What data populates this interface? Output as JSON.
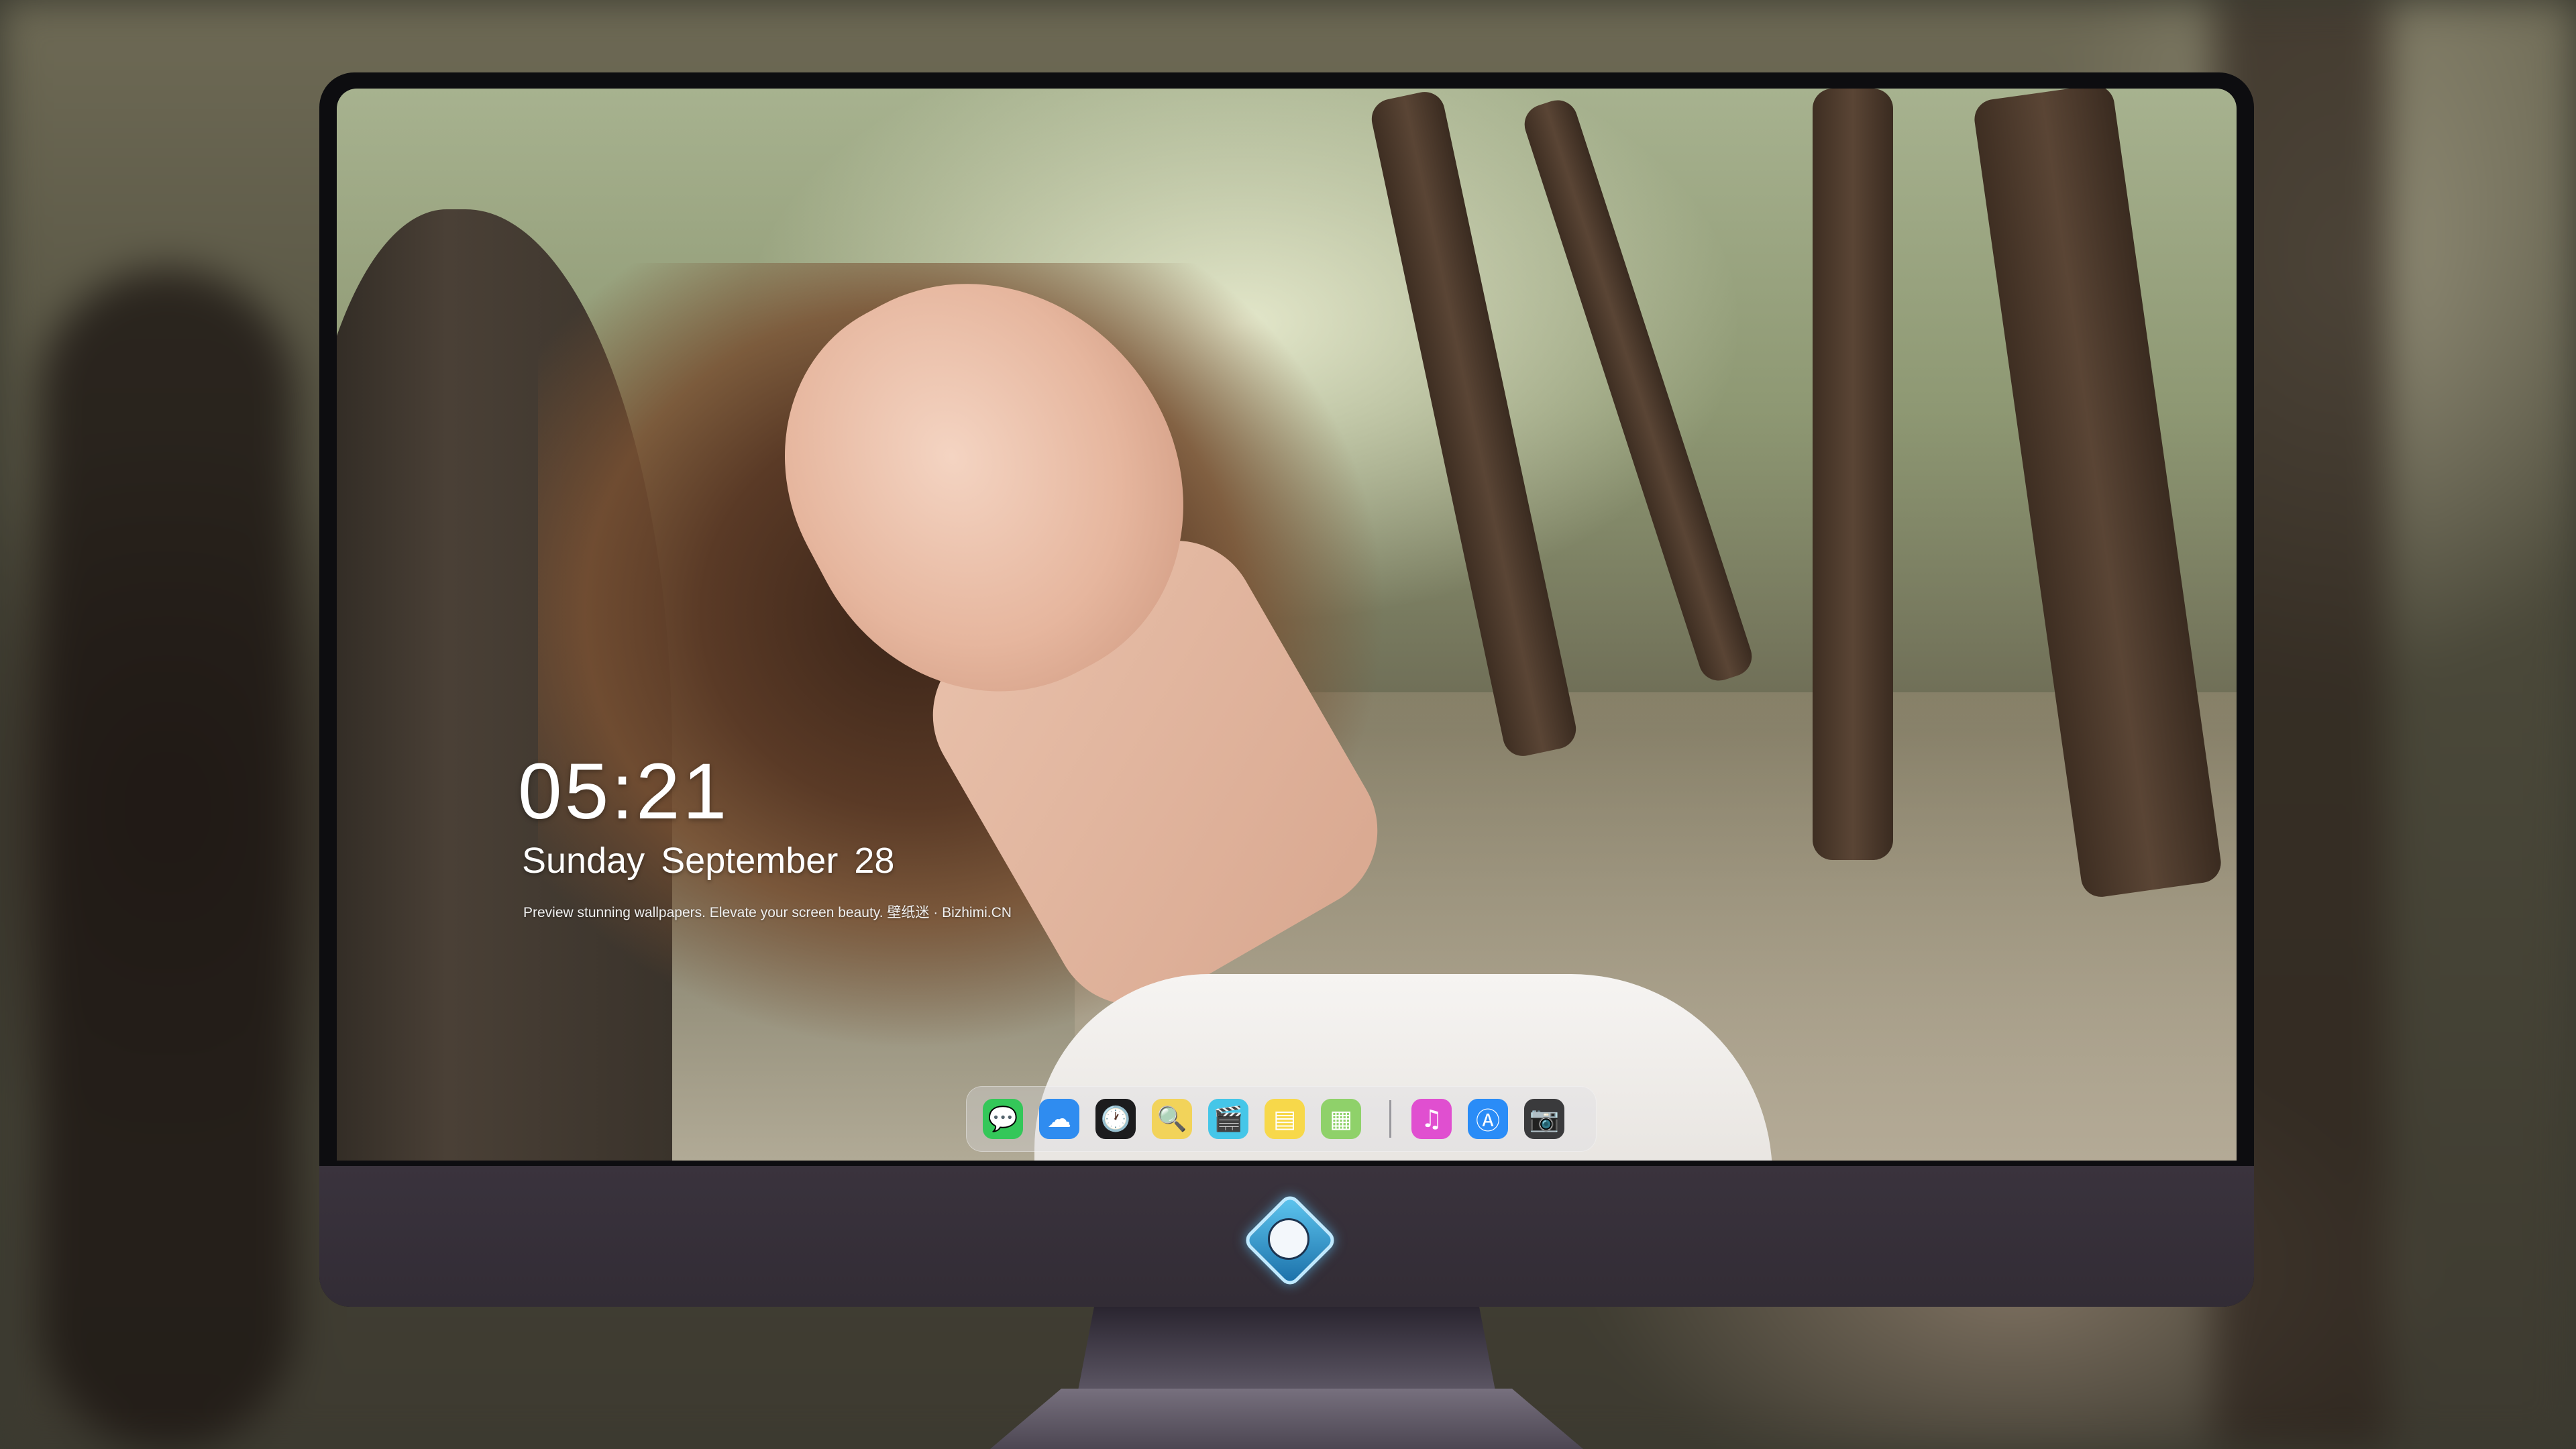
{
  "lockscreen": {
    "time": "05:21",
    "weekday": "Sunday",
    "month": "September",
    "day": "28",
    "tagline": "Preview stunning wallpapers. Elevate your screen beauty. 壁纸迷 · Bizhimi.CN"
  },
  "dock": {
    "apps": [
      {
        "name": "messages-icon",
        "glyph": "💬",
        "color": "#34c759"
      },
      {
        "name": "weather-icon",
        "glyph": "☁",
        "color": "#2f8cf0"
      },
      {
        "name": "clock-icon",
        "glyph": "🕐",
        "color": "#1c1c1e"
      },
      {
        "name": "preview-icon",
        "glyph": "🔍",
        "color": "#f2d35a"
      },
      {
        "name": "clips-icon",
        "glyph": "🎬",
        "color": "#45c6e8"
      },
      {
        "name": "notes-icon",
        "glyph": "▤",
        "color": "#f7d84a"
      },
      {
        "name": "photo-browser-icon",
        "glyph": "▦",
        "color": "#8fd16a"
      }
    ],
    "apps_right": [
      {
        "name": "music-icon",
        "glyph": "♫",
        "color": "#e04fd0"
      },
      {
        "name": "app-store-icon",
        "glyph": "Ⓐ",
        "color": "#2a8cf7"
      },
      {
        "name": "camera-icon",
        "glyph": "📷",
        "color": "#3a3a3c"
      }
    ]
  },
  "colors": {
    "chin": "#3a333d",
    "bezel": "#0d0d10"
  },
  "chin_logo": "fox-mascot-logo"
}
